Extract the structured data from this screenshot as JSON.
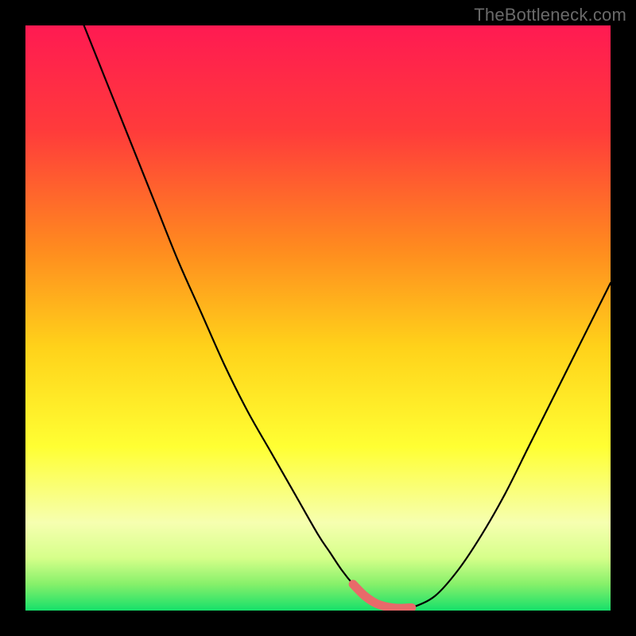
{
  "watermark": "TheBottleneck.com",
  "colors": {
    "frame": "#000000",
    "grad_stops": [
      {
        "offset": 0.0,
        "color": "#ff1a52"
      },
      {
        "offset": 0.18,
        "color": "#ff3b3b"
      },
      {
        "offset": 0.38,
        "color": "#ff8a1f"
      },
      {
        "offset": 0.55,
        "color": "#ffd21a"
      },
      {
        "offset": 0.72,
        "color": "#ffff33"
      },
      {
        "offset": 0.85,
        "color": "#f6ffb0"
      },
      {
        "offset": 0.91,
        "color": "#d6ff8a"
      },
      {
        "offset": 0.955,
        "color": "#86f06a"
      },
      {
        "offset": 1.0,
        "color": "#16e06a"
      }
    ],
    "curve": "#000000",
    "thick_segment": "#e86a6a"
  },
  "chart_data": {
    "type": "line",
    "title": "",
    "xlabel": "",
    "ylabel": "",
    "xlim": [
      0,
      100
    ],
    "ylim": [
      0,
      100
    ],
    "grid": false,
    "legend": false,
    "series": [
      {
        "name": "bottleneck-curve",
        "x": [
          10,
          14,
          18,
          22,
          26,
          30,
          34,
          38,
          42,
          46,
          50,
          52,
          54,
          56,
          58,
          60,
          62,
          64,
          66,
          70,
          74,
          78,
          82,
          86,
          90,
          94,
          98,
          100
        ],
        "y": [
          100,
          90,
          80,
          70,
          60,
          51,
          42,
          34,
          27,
          20,
          13,
          10,
          7,
          4.5,
          2.5,
          1.2,
          0.6,
          0.4,
          0.5,
          2.5,
          7,
          13,
          20,
          28,
          36,
          44,
          52,
          56
        ]
      }
    ],
    "annotations": [
      {
        "name": "optimum-band",
        "x_range": [
          55,
          66
        ],
        "note": "thick pink low-bottleneck segment"
      }
    ]
  }
}
